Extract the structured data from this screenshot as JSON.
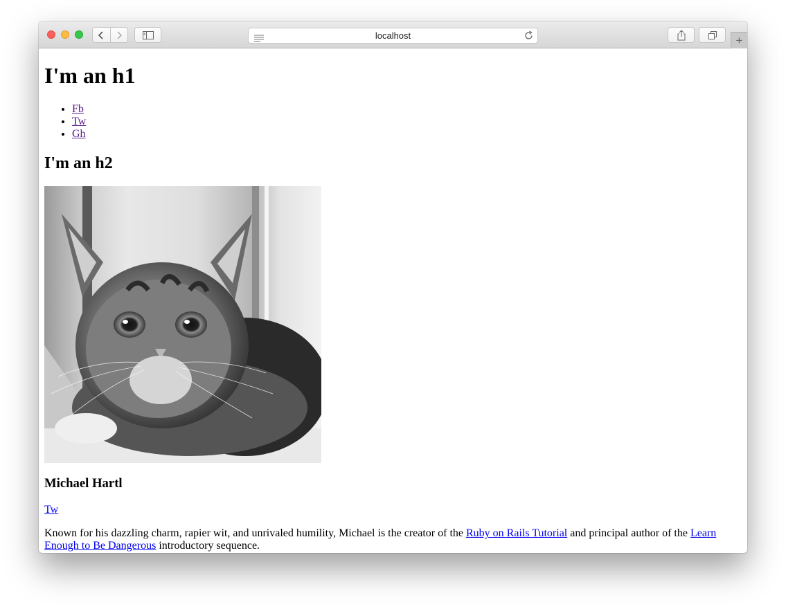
{
  "browser": {
    "url": "localhost"
  },
  "page": {
    "h1": "I'm an h1",
    "social_links": [
      {
        "label": "Fb"
      },
      {
        "label": "Tw"
      },
      {
        "label": "Gh"
      }
    ],
    "h2": "I'm an h2",
    "image": {
      "description": "kitten-photo"
    },
    "bio": {
      "name": "Michael Hartl",
      "link_label": "Tw",
      "text_before": "Known for his dazzling charm, rapier wit, and unrivaled humility, Michael is the creator of the ",
      "link1": "Ruby on Rails Tutorial",
      "text_middle": " and principal author of the ",
      "link2": "Learn Enough to Be Dangerous",
      "text_after": " introductory sequence."
    }
  },
  "colors": {
    "link": "#0000ee",
    "visited_link": "#551a8b"
  }
}
